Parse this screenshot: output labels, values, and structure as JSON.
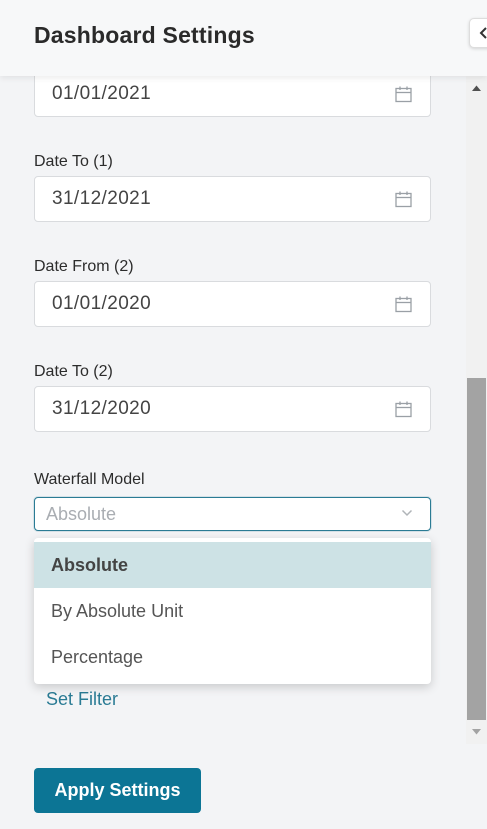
{
  "header": {
    "title": "Dashboard Settings"
  },
  "fields": {
    "date_from_1": {
      "value": "01/01/2021"
    },
    "date_to_1": {
      "label": "Date To (1)",
      "value": "31/12/2021"
    },
    "date_from_2": {
      "label": "Date From (2)",
      "value": "01/01/2020"
    },
    "date_to_2": {
      "label": "Date To (2)",
      "value": "31/12/2020"
    },
    "waterfall_model": {
      "label": "Waterfall Model",
      "placeholder": "Absolute",
      "options": [
        "Absolute",
        "By Absolute Unit",
        "Percentage"
      ],
      "highlighted": "Absolute"
    }
  },
  "set_filter_label": "Set Filter",
  "apply_button_label": "Apply Settings",
  "colors": {
    "accent": "#0c7595",
    "focus_border": "#2a7b94",
    "selected_option_bg": "#cde2e5"
  },
  "icons": [
    "calendar-icon",
    "chevron-down-icon",
    "chevron-left-icon",
    "scroll-up-arrow-icon",
    "scroll-down-arrow-icon"
  ]
}
